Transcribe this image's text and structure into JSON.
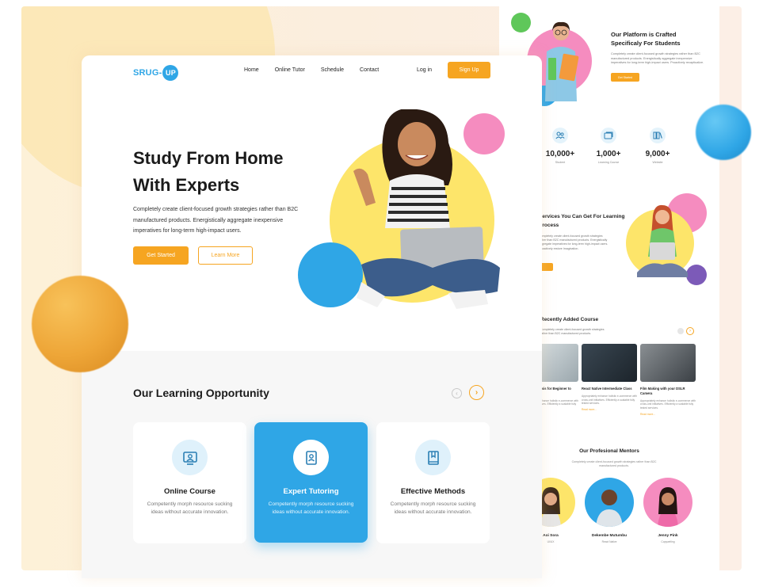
{
  "main": {
    "logo": {
      "text": "SRUG-",
      "badge": "UP"
    },
    "nav": [
      "Home",
      "Online Tutor",
      "Schedule",
      "Contact"
    ],
    "login": "Log in",
    "signup": "Sign Up",
    "hero": {
      "title": "Study From Home With Experts",
      "text": "Completely create client-focused growth strategies rather than B2C manufactured products. Energistically aggregate inexpensive imperatives for long-term high-impact users.",
      "start": "Get Started",
      "more": "Learn More"
    },
    "learning": {
      "title": "Our Learning Opportunity",
      "prev_icon": "arrow-left-icon",
      "next_icon": "arrow-right-icon",
      "cards": [
        {
          "title": "Online Course",
          "desc": "Competently morph resource sucking ideas without accurate innovation.",
          "icon": "online-course-icon"
        },
        {
          "title": "Expert Tutoring",
          "desc": "Competently morph resource sucking ideas without accurate innovation.",
          "icon": "expert-tutoring-icon"
        },
        {
          "title": "Effective Methods",
          "desc": "Competently morph resource sucking ideas without accurate innovation.",
          "icon": "effective-methods-icon"
        }
      ]
    }
  },
  "side": {
    "platform": {
      "title": "Our Platform is Crafted Specificaly For Students",
      "text": "Completely create client-focused growth strategies rather than B2C manufactured products. Energistically aggregate inexpensive imperatives for long-term high-impact users. Proactively recaptiualize.",
      "button": "Get Started"
    },
    "stats": [
      {
        "value": "10,000+",
        "label": "Student",
        "icon": "users-icon"
      },
      {
        "value": "1,000+",
        "label": "Learning Course",
        "icon": "course-icon"
      },
      {
        "value": "9,000+",
        "label": "Website",
        "icon": "books-icon"
      }
    ],
    "services": {
      "title": "Services You Can Get For Learning Process",
      "text": "Completely create client-focused growth strategies rather than B2C manufactured products. Energistically aggregate imperatives for long-term high-impact users. Proactively restore Imagination."
    },
    "courses": {
      "title": "Recently Added Course",
      "text": "Completely create client-focused growth strategies rather than B2C manufactured products.",
      "items": [
        {
          "title": "Stock Analysis for Beginner to Advance",
          "desc": "Appropriately enhance holistic e-commerce with cross-unit initiatives. Efficiently a scalable fully tested services.",
          "link": "Read more..."
        },
        {
          "title": "React Native Intermediate Class",
          "desc": "Appropriately enhance holistic e-commerce with cross-unit initiatives. Efficiently a scalable fully tested services.",
          "link": "Read more..."
        },
        {
          "title": "Film Making with your DSLR Camera",
          "desc": "Appropriately enhance holistic e-commerce with cross-unit initiatives. Efficiently a scalable fully tested services.",
          "link": "Read more..."
        }
      ]
    },
    "mentors": {
      "title": "Our Profesional Mentors",
      "text": "Completely create client-focused growth strategies rather than B2C manufactured products.",
      "people": [
        {
          "name": "Aoi Sora",
          "role": "UI/UX"
        },
        {
          "name": "Dekembe Mutumbu",
          "role": "React Native"
        },
        {
          "name": "Jenny Pink",
          "role": "Copywriting"
        }
      ]
    }
  },
  "colors": {
    "accent": "#f6a521",
    "blue": "#2fa6e6",
    "pink": "#f58cbf",
    "yellow": "#fde56a"
  }
}
